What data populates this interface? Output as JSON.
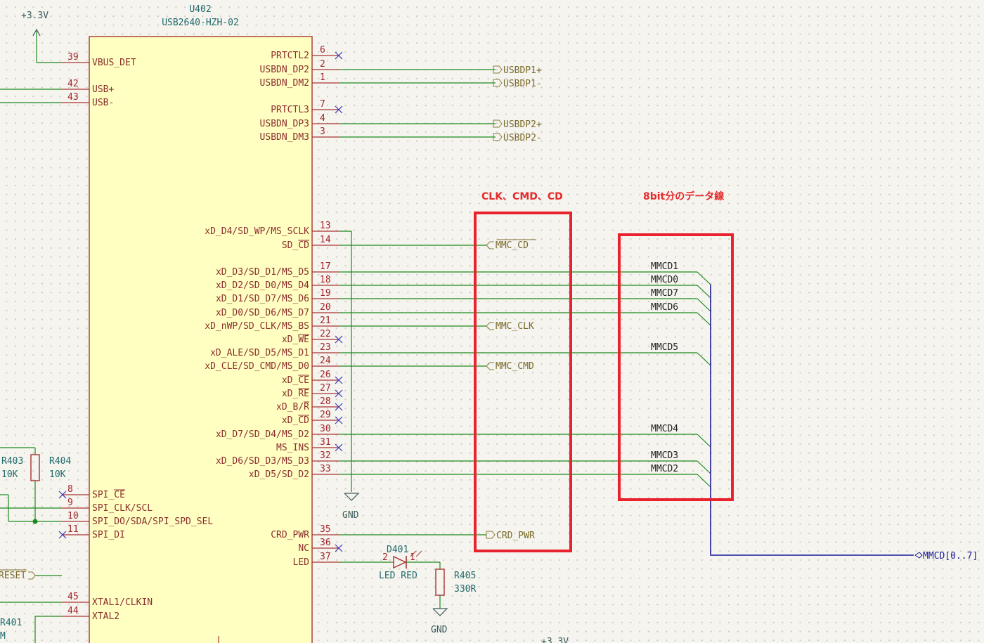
{
  "component": {
    "ref": "U402",
    "value": "USB2640-HZH-02"
  },
  "power": {
    "top": "+3.3V",
    "bottom": "+3.3V",
    "gnd1": "GND",
    "gnd2": "GND"
  },
  "left_pins": [
    {
      "num": "39",
      "name": "VBUS_DET"
    },
    {
      "num": "42",
      "name": "USB+"
    },
    {
      "num": "43",
      "name": "USB-"
    },
    {
      "num": "8",
      "name": "SPI_CE"
    },
    {
      "num": "9",
      "name": "SPI_CLK/SCL"
    },
    {
      "num": "10",
      "name": "SPI_DO/SDA/SPI_SPD_SEL"
    },
    {
      "num": "11",
      "name": "SPI_DI"
    },
    {
      "num": "45",
      "name": "XTAL1/CLKIN"
    },
    {
      "num": "44",
      "name": "XTAL2"
    }
  ],
  "right_pins": [
    {
      "num": "6",
      "name": "PRTCTL2"
    },
    {
      "num": "2",
      "name": "USBDN_DP2"
    },
    {
      "num": "1",
      "name": "USBDN_DM2"
    },
    {
      "num": "7",
      "name": "PRTCTL3"
    },
    {
      "num": "4",
      "name": "USBDN_DP3"
    },
    {
      "num": "3",
      "name": "USBDN_DM3"
    },
    {
      "num": "13",
      "name": "xD_D4/SD_WP/MS_SCLK"
    },
    {
      "num": "14",
      "name": "SD_CD"
    },
    {
      "num": "17",
      "name": "xD_D3/SD_D1/MS_D5"
    },
    {
      "num": "18",
      "name": "xD_D2/SD_D0/MS_D4"
    },
    {
      "num": "19",
      "name": "xD_D1/SD_D7/MS_D6"
    },
    {
      "num": "20",
      "name": "xD_D0/SD_D6/MS_D7"
    },
    {
      "num": "21",
      "name": "xD_nWP/SD_CLK/MS_BS"
    },
    {
      "num": "22",
      "name": "xD_WE"
    },
    {
      "num": "23",
      "name": "xD_ALE/SD_D5/MS_D1"
    },
    {
      "num": "24",
      "name": "xD_CLE/SD_CMD/MS_D0"
    },
    {
      "num": "26",
      "name": "xD_CE"
    },
    {
      "num": "27",
      "name": "xD_RE"
    },
    {
      "num": "28",
      "name": "xD_B/R"
    },
    {
      "num": "29",
      "name": "xD_CD"
    },
    {
      "num": "30",
      "name": "xD_D7/SD_D4/MS_D2"
    },
    {
      "num": "31",
      "name": "MS_INS"
    },
    {
      "num": "32",
      "name": "xD_D6/SD_D3/MS_D3"
    },
    {
      "num": "33",
      "name": "xD_D5/SD_D2"
    },
    {
      "num": "35",
      "name": "CRD_PWR"
    },
    {
      "num": "36",
      "name": "NC"
    },
    {
      "num": "37",
      "name": "LED"
    }
  ],
  "global_labels": [
    "USBDP1+",
    "USBDP1-",
    "USBDP2+",
    "USBDP2-",
    "MMC_CD",
    "MMC_CLK",
    "MMC_CMD",
    "CRD_PWR",
    "MMCD[0..7]",
    "RESET"
  ],
  "bus_nets": [
    "MMCD1",
    "MMCD0",
    "MMCD7",
    "MMCD6",
    "MMCD5",
    "MMCD4",
    "MMCD3",
    "MMCD2"
  ],
  "parts": {
    "r403": {
      "ref": "R403",
      "value": "10K"
    },
    "r404": {
      "ref": "R404",
      "value": "10K"
    },
    "r405": {
      "ref": "R405",
      "value": "330R"
    },
    "d401": {
      "ref": "D401",
      "value": "LED RED",
      "pin2": "2",
      "pin1": "1"
    },
    "r401_partial": {
      "ref": "R401",
      "value": "M"
    }
  },
  "annotations": {
    "box1": "CLK、CMD、CD",
    "box2": "8bit分のデータ線"
  },
  "colors": {
    "wire": "#1c8a1c",
    "bus": "#1a1a99",
    "pin": "#a33",
    "body_fill": "#ffffc2",
    "highlight": "#e8232d"
  }
}
